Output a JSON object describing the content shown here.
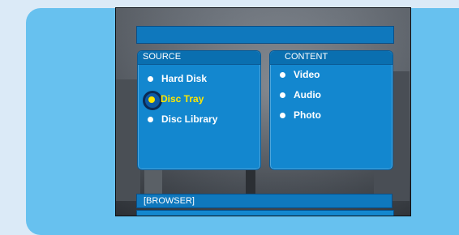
{
  "source": {
    "header": "SOURCE",
    "items": [
      {
        "label": "Hard Disk",
        "selected": false
      },
      {
        "label": "Disc Tray",
        "selected": true
      },
      {
        "label": "Disc Library",
        "selected": false
      }
    ]
  },
  "content": {
    "header": "CONTENT",
    "items": [
      {
        "label": "Video"
      },
      {
        "label": "Audio"
      },
      {
        "label": "Photo"
      }
    ]
  },
  "browser": {
    "label": "[BROWSER]"
  },
  "colors": {
    "panel_bg": "#67c1ef",
    "box_bg": "#1387cf",
    "selected_text": "#ffe800",
    "text": "#ffffff"
  },
  "icons": {
    "selection_marker": "radio-selected-icon",
    "arrow": "right-arrow-icon"
  }
}
